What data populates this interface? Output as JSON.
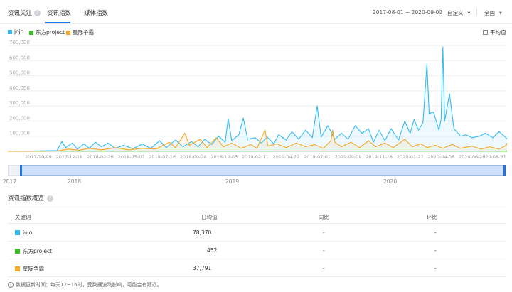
{
  "header": {
    "title": "资讯关注",
    "tabs": [
      {
        "label": "资讯指数",
        "active": true
      },
      {
        "label": "媒体指数",
        "active": false
      }
    ],
    "date_range": "2017-08-01 ~ 2020-09-02",
    "custom_label": "自定义",
    "region_label": "全国"
  },
  "legend": {
    "items": [
      {
        "name": "jojo",
        "color": "#33bbf0"
      },
      {
        "name": "东方project",
        "color": "#3dbf26"
      },
      {
        "name": "星际争霸",
        "color": "#f5a623"
      }
    ],
    "average_label": "平均值"
  },
  "chart_data": {
    "type": "area",
    "yticks": [
      "700,000",
      "600,000",
      "500,000",
      "400,000",
      "300,000",
      "200,000",
      "100,000"
    ],
    "ylim": [
      0,
      700000
    ],
    "xticks": [
      "2017-10-09",
      "2017-12-18",
      "2018-02-26",
      "2018-05-07",
      "2018-07-16",
      "2018-09-24",
      "2018-12-03",
      "2019-02-11",
      "2019-04-22",
      "2019-07-01",
      "2019-09-09",
      "2019-11-18",
      "2020-01-27",
      "2020-04-06",
      "2020-06-15",
      "2020-08-31"
    ],
    "x_start": "2017-08-01",
    "x_end": "2020-09-02",
    "series": [
      {
        "name": "jojo",
        "color": "#33bbf0",
        "points": [
          [
            "2017-08-01",
            0
          ],
          [
            "2017-11-20",
            5000
          ],
          [
            "2017-12-01",
            65000
          ],
          [
            "2017-12-10",
            25000
          ],
          [
            "2017-12-25",
            55000
          ],
          [
            "2018-01-05",
            15000
          ],
          [
            "2018-01-20",
            50000
          ],
          [
            "2018-02-01",
            20000
          ],
          [
            "2018-02-15",
            60000
          ],
          [
            "2018-03-01",
            30000
          ],
          [
            "2018-03-15",
            55000
          ],
          [
            "2018-04-01",
            20000
          ],
          [
            "2018-04-20",
            40000
          ],
          [
            "2018-05-10",
            18000
          ],
          [
            "2018-06-01",
            48000
          ],
          [
            "2018-06-20",
            20000
          ],
          [
            "2018-07-10",
            70000
          ],
          [
            "2018-07-25",
            25000
          ],
          [
            "2018-08-15",
            75000
          ],
          [
            "2018-09-01",
            30000
          ],
          [
            "2018-09-20",
            65000
          ],
          [
            "2018-10-05",
            30000
          ],
          [
            "2018-10-20",
            80000
          ],
          [
            "2018-11-05",
            45000
          ],
          [
            "2018-11-20",
            100000
          ],
          [
            "2018-12-05",
            60000
          ],
          [
            "2018-12-12",
            215000
          ],
          [
            "2018-12-20",
            70000
          ],
          [
            "2019-01-05",
            110000
          ],
          [
            "2019-01-15",
            220000
          ],
          [
            "2019-01-25",
            80000
          ],
          [
            "2019-02-11",
            90000
          ],
          [
            "2019-02-25",
            55000
          ],
          [
            "2019-03-10",
            95000
          ],
          [
            "2019-03-25",
            50000
          ],
          [
            "2019-04-05",
            110000
          ],
          [
            "2019-04-22",
            75000
          ],
          [
            "2019-05-05",
            130000
          ],
          [
            "2019-05-20",
            80000
          ],
          [
            "2019-06-05",
            140000
          ],
          [
            "2019-06-20",
            90000
          ],
          [
            "2019-07-01",
            300000
          ],
          [
            "2019-07-10",
            95000
          ],
          [
            "2019-07-25",
            170000
          ],
          [
            "2019-08-10",
            80000
          ],
          [
            "2019-08-25",
            120000
          ],
          [
            "2019-09-09",
            80000
          ],
          [
            "2019-09-25",
            170000
          ],
          [
            "2019-10-10",
            120000
          ],
          [
            "2019-10-25",
            150000
          ],
          [
            "2019-11-05",
            60000
          ],
          [
            "2019-11-18",
            140000
          ],
          [
            "2019-12-01",
            70000
          ],
          [
            "2019-12-15",
            150000
          ],
          [
            "2020-01-01",
            75000
          ],
          [
            "2020-01-15",
            200000
          ],
          [
            "2020-01-27",
            120000
          ],
          [
            "2020-02-05",
            210000
          ],
          [
            "2020-02-15",
            140000
          ],
          [
            "2020-02-25",
            190000
          ],
          [
            "2020-03-05",
            580000
          ],
          [
            "2020-03-10",
            250000
          ],
          [
            "2020-03-20",
            260000
          ],
          [
            "2020-04-01",
            140000
          ],
          [
            "2020-04-06",
            210000
          ],
          [
            "2020-04-10",
            690000
          ],
          [
            "2020-04-14",
            200000
          ],
          [
            "2020-04-25",
            380000
          ],
          [
            "2020-05-05",
            150000
          ],
          [
            "2020-05-20",
            100000
          ],
          [
            "2020-06-01",
            110000
          ],
          [
            "2020-06-15",
            90000
          ],
          [
            "2020-07-01",
            100000
          ],
          [
            "2020-07-15",
            120000
          ],
          [
            "2020-08-01",
            90000
          ],
          [
            "2020-08-15",
            130000
          ],
          [
            "2020-08-31",
            90000
          ],
          [
            "2020-09-02",
            80000
          ]
        ]
      },
      {
        "name": "东方project",
        "color": "#3dbf26",
        "points": [
          [
            "2017-08-01",
            0
          ],
          [
            "2017-11-20",
            2000
          ],
          [
            "2017-12-10",
            1500
          ],
          [
            "2018-06-01",
            1200
          ],
          [
            "2019-01-01",
            1500
          ],
          [
            "2019-06-01",
            2000
          ],
          [
            "2020-01-01",
            1500
          ],
          [
            "2020-06-01",
            1200
          ],
          [
            "2020-09-02",
            1500
          ]
        ]
      },
      {
        "name": "星际争霸",
        "color": "#f5a623",
        "points": [
          [
            "2017-08-01",
            0
          ],
          [
            "2017-11-20",
            3000
          ],
          [
            "2017-12-15",
            15000
          ],
          [
            "2018-01-10",
            8000
          ],
          [
            "2018-02-01",
            20000
          ],
          [
            "2018-03-01",
            10000
          ],
          [
            "2018-04-01",
            25000
          ],
          [
            "2018-05-01",
            10000
          ],
          [
            "2018-06-01",
            20000
          ],
          [
            "2018-07-01",
            15000
          ],
          [
            "2018-08-01",
            60000
          ],
          [
            "2018-08-15",
            25000
          ],
          [
            "2018-09-05",
            120000
          ],
          [
            "2018-09-15",
            40000
          ],
          [
            "2018-10-10",
            80000
          ],
          [
            "2018-10-25",
            25000
          ],
          [
            "2018-11-15",
            90000
          ],
          [
            "2018-12-01",
            30000
          ],
          [
            "2018-12-20",
            55000
          ],
          [
            "2019-01-10",
            20000
          ],
          [
            "2019-02-01",
            45000
          ],
          [
            "2019-02-15",
            20000
          ],
          [
            "2019-03-05",
            140000
          ],
          [
            "2019-03-12",
            35000
          ],
          [
            "2019-04-01",
            50000
          ],
          [
            "2019-04-22",
            25000
          ],
          [
            "2019-05-15",
            55000
          ],
          [
            "2019-06-05",
            30000
          ],
          [
            "2019-06-25",
            45000
          ],
          [
            "2019-07-15",
            20000
          ],
          [
            "2019-08-01",
            70000
          ],
          [
            "2019-08-05",
            140000
          ],
          [
            "2019-08-10",
            60000
          ],
          [
            "2019-08-25",
            30000
          ],
          [
            "2019-09-15",
            60000
          ],
          [
            "2019-10-05",
            25000
          ],
          [
            "2019-10-25",
            70000
          ],
          [
            "2019-11-10",
            30000
          ],
          [
            "2019-12-01",
            55000
          ],
          [
            "2019-12-20",
            25000
          ],
          [
            "2020-01-15",
            80000
          ],
          [
            "2020-02-01",
            30000
          ],
          [
            "2020-02-20",
            50000
          ],
          [
            "2020-03-05",
            25000
          ],
          [
            "2020-03-25",
            40000
          ],
          [
            "2020-04-10",
            20000
          ],
          [
            "2020-05-01",
            45000
          ],
          [
            "2020-05-20",
            20000
          ],
          [
            "2020-06-15",
            35000
          ],
          [
            "2020-07-05",
            15000
          ],
          [
            "2020-07-25",
            30000
          ],
          [
            "2020-08-15",
            15000
          ],
          [
            "2020-08-31",
            40000
          ],
          [
            "2020-09-02",
            55000
          ]
        ]
      }
    ]
  },
  "slider": {
    "years": [
      "2017",
      "2018",
      "2019",
      "2020"
    ]
  },
  "overview": {
    "title": "资讯指数概览",
    "columns": [
      "关键词",
      "日均值",
      "同比",
      "环比"
    ],
    "rows": [
      {
        "keyword": "jojo",
        "color": "#33bbf0",
        "daily_avg": "78,370",
        "yoy": "-",
        "mom": "-"
      },
      {
        "keyword": "东方project",
        "color": "#3dbf26",
        "daily_avg": "452",
        "yoy": "-",
        "mom": "-"
      },
      {
        "keyword": "星际争霸",
        "color": "#f5a623",
        "daily_avg": "37,791",
        "yoy": "-",
        "mom": "-"
      }
    ]
  },
  "footnote": "数据更新时间：每天12~16时，受数据波动影响，可能会有延迟。"
}
